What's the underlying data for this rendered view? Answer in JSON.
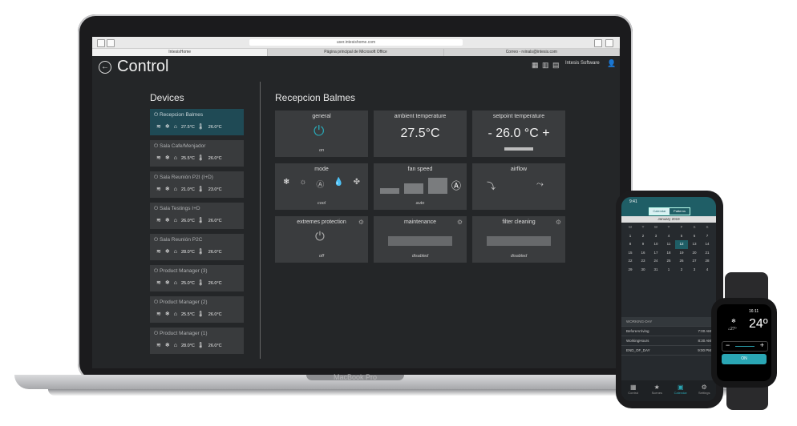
{
  "laptop": {
    "brand_label": "MacBook Pro"
  },
  "browser": {
    "url": "user.intesishome.com",
    "tabs": [
      {
        "label": "IntesisHome",
        "active": true
      },
      {
        "label": "Página principal de Microsoft Office",
        "active": false
      },
      {
        "label": "Correo - rvinals@intesis.com",
        "active": false
      }
    ]
  },
  "app": {
    "back_icon": "arrow-left-circle-icon",
    "title": "Control",
    "account_name": "Intesis Software",
    "devices_title": "Devices",
    "devices": [
      {
        "name": "Recepcion Balmes",
        "ambient": "27.5°C",
        "setpoint": "26.0°C",
        "active": true
      },
      {
        "name": "Sala Cafe/Menjador",
        "ambient": "25.5°C",
        "setpoint": "26.0°C",
        "active": false
      },
      {
        "name": "Sala Reunión P2I (I+D)",
        "ambient": "21.0°C",
        "setpoint": "23.0°C",
        "active": false
      },
      {
        "name": "Sala Testings I+D",
        "ambient": "26.0°C",
        "setpoint": "26.0°C",
        "active": false
      },
      {
        "name": "Sala Reunión P2C",
        "ambient": "28.0°C",
        "setpoint": "26.0°C",
        "active": false
      },
      {
        "name": "Product Manager (3)",
        "ambient": "25.0°C",
        "setpoint": "26.0°C",
        "active": false
      },
      {
        "name": "Product Manager (2)",
        "ambient": "25.5°C",
        "setpoint": "26.0°C",
        "active": false
      },
      {
        "name": "Product Manager (1)",
        "ambient": "28.0°C",
        "setpoint": "26.0°C",
        "active": false
      }
    ],
    "selected_device_title": "Recepcion Balmes",
    "tiles": {
      "general": {
        "title": "general",
        "status": "on"
      },
      "ambient": {
        "title": "ambient temperature",
        "value": "27.5°C"
      },
      "setpoint": {
        "title": "setpoint temperature",
        "value": "- 26.0 °C +"
      },
      "mode": {
        "title": "mode",
        "status": "cool"
      },
      "fan": {
        "title": "fan speed",
        "status": "auto"
      },
      "airflow": {
        "title": "airflow"
      },
      "extremes": {
        "title": "extremes protection",
        "status": "off"
      },
      "maintenance": {
        "title": "maintenance",
        "status": "disabled"
      },
      "filter": {
        "title": "filter cleaning",
        "status": "disabled"
      }
    }
  },
  "phone": {
    "time": "9:41",
    "segments": [
      "Calendar",
      "Patterns"
    ],
    "month": "January 2019",
    "weekdays": [
      "M",
      "T",
      "W",
      "T",
      "F",
      "S",
      "S"
    ],
    "weeks": [
      [
        "1",
        "2",
        "3",
        "4",
        "5",
        "6",
        "7"
      ],
      [
        "8",
        "9",
        "10",
        "11",
        "12",
        "13",
        "14"
      ],
      [
        "15",
        "16",
        "17",
        "18",
        "19",
        "20",
        "21"
      ],
      [
        "22",
        "23",
        "24",
        "25",
        "26",
        "27",
        "28"
      ],
      [
        "29",
        "30",
        "31",
        "1",
        "2",
        "3",
        "4"
      ]
    ],
    "list_header": "WORKING-DAY",
    "list": [
      {
        "label": "BeforeArriving",
        "time": "7:00 AM"
      },
      {
        "label": "WorkingHours",
        "time": "8:30 AM"
      },
      {
        "label": "END_OF_DAY",
        "time": "9:00 PM"
      }
    ],
    "tabbar": [
      "Control",
      "Scenes",
      "Calendar",
      "Settings"
    ]
  },
  "watch": {
    "time": "16:11",
    "setpoint": "24º",
    "ambient": "27º",
    "button": "ON"
  },
  "colors": {
    "accent": "#2aa6b4",
    "active_device": "#1f4a55",
    "tile": "#3a3c3e",
    "background": "#242628"
  }
}
